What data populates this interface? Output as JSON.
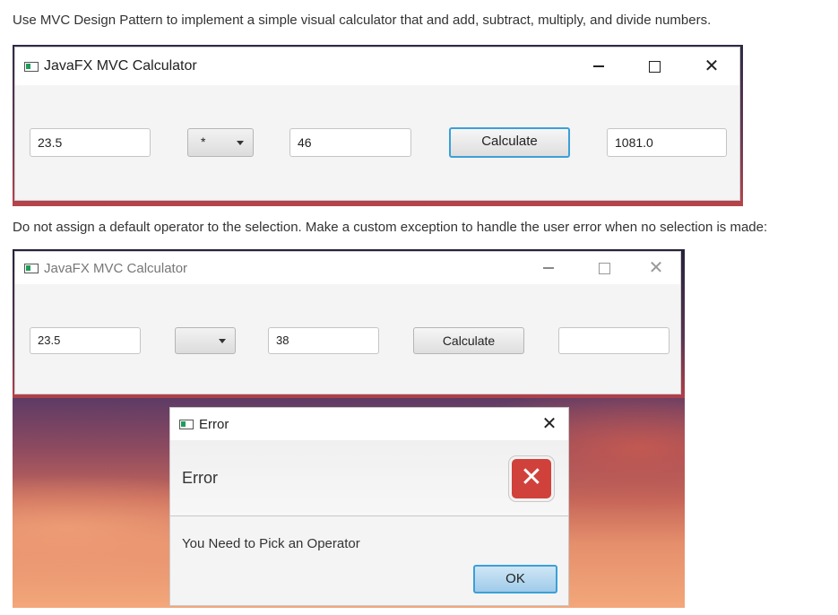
{
  "instructions": {
    "line1": "Use MVC Design Pattern to implement a simple visual calculator that and add, subtract, multiply, and divide numbers.",
    "line2": "Do not assign a default operator to the selection. Make a custom exception to handle the user error when no selection is made:"
  },
  "window1": {
    "title": "JavaFX MVC Calculator",
    "first_number": "23.5",
    "operator": "*",
    "second_number": "46",
    "calculate_label": "Calculate",
    "result": "1081.0"
  },
  "window2": {
    "title": "JavaFX MVC Calculator",
    "first_number": "23.5",
    "operator": "",
    "second_number": "38",
    "calculate_label": "Calculate",
    "result": ""
  },
  "error_dialog": {
    "title": "Error",
    "header": "Error",
    "message": "You Need to Pick an Operator",
    "ok_label": "OK",
    "icon": "error-x-icon"
  },
  "window_controls": {
    "minimize": "minimize-icon",
    "maximize": "maximize-icon",
    "close": "close-icon"
  },
  "colors": {
    "focus_blue": "#3aa0d8",
    "error_red": "#d0413b",
    "window_bg": "#f4f4f4"
  }
}
